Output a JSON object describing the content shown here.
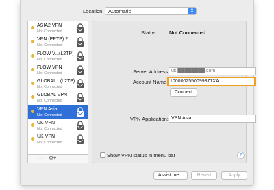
{
  "location": {
    "label": "Location:",
    "value": "Automatic"
  },
  "services": [
    {
      "name": "ASIA2 VPN",
      "status": "Not Connected"
    },
    {
      "name": "VPN (PPTP) 2",
      "status": "Not Connected"
    },
    {
      "name": "FLOW V...(L2TP)",
      "status": "Not Connected"
    },
    {
      "name": "FLOW VPN",
      "status": "Not Connected"
    },
    {
      "name": "GLOBAL...(L2TP)",
      "status": "Not Connected"
    },
    {
      "name": "GLOBAL VPN",
      "status": "Not Connected"
    },
    {
      "name": "VPN Asia",
      "status": "Not Connected"
    },
    {
      "name": "UK VPN",
      "status": "Not Connected"
    },
    {
      "name": "UK VPN",
      "status": "Not Connected"
    }
  ],
  "toolbar": {
    "add": "+",
    "remove": "—",
    "gear": "⚙▾"
  },
  "detail": {
    "status_label": "Status:",
    "status_value": "Not Connected",
    "server_address_label": "Server Address:",
    "server_address_value": "uk.████████.com",
    "account_name_label": "Account Name:",
    "account_name_value": "1000002550099371XA",
    "connect_label": "Connect",
    "vpn_application_label": "VPN Application:",
    "vpn_application_value": "VPN Asia"
  },
  "show_status_label": "Show VPN status in menu bar",
  "help": "?",
  "buttons": {
    "assist": "Assist me...",
    "revert": "Revert",
    "apply": "Apply"
  },
  "colors": {
    "selection": "#2f70d8",
    "status_dot": "#e8b63a",
    "focus_ring": "#f0a020"
  }
}
